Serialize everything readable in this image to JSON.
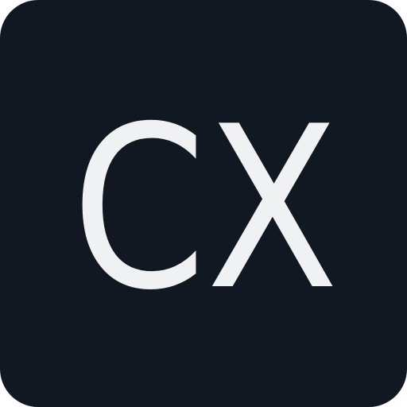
{
  "icon": {
    "monogram": "CX",
    "background_color": "#121821",
    "text_color": "#f0f1f3"
  }
}
